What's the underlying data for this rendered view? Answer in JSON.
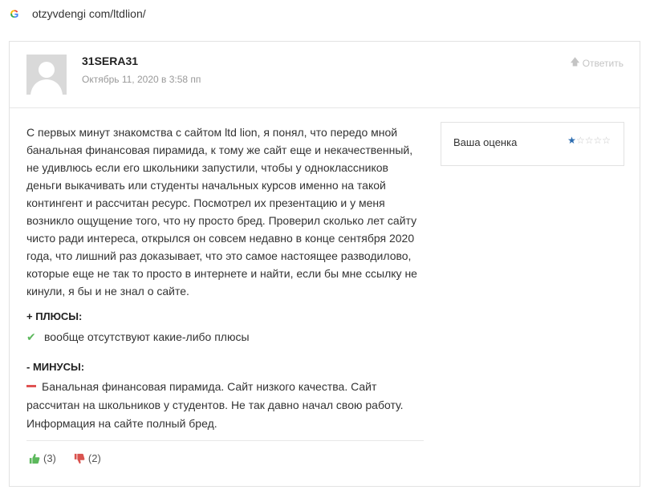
{
  "browser": {
    "url": "otzyvdengi com/ltdlion/"
  },
  "review": {
    "author": "31SERA31",
    "date": "Октябрь 11, 2020 в 3:58 пп",
    "reply_label": "Ответить",
    "body": "С первых минут знакомства с сайтом ltd lion, я понял, что передо мной банальная финансовая пирамида, к тому же сайт еще и некачественный, не удивлюсь если его школьники запустили, чтобы у одноклассников деньги выкачивать или студенты начальных курсов именно на такой контингент и рассчитан ресурс. Посмотрел их презентацию и у меня возникло ощущение того, что ну просто бред. Проверил сколько лет сайту чисто ради интереса, открылся он совсем недавно в конце сентября 2020 года, что лишний раз доказывает, что это самое настоящее разводилово, которые еще не так то просто в интернете и найти, если бы мне ссылку не кинули, я бы и не знал о сайте.",
    "rating": {
      "label": "Ваша оценка",
      "value": 1,
      "max": 5
    },
    "pros": {
      "title": "+ ПЛЮСЫ:",
      "items": [
        "вообще отсутствуют какие-либо плюсы"
      ]
    },
    "cons": {
      "title": "- МИНУСЫ:",
      "text": "Банальная финансовая пирамида. Сайт низкого качества. Сайт рассчитан на школьников у студентов. Не так давно начал свою работу. Информация на сайте полный бред."
    },
    "votes": {
      "up": "(3)",
      "down": "(2)"
    }
  },
  "colors": {
    "accent_blue": "#2b6cb0",
    "check_green": "#5cb85c",
    "minus_red": "#e05252",
    "thumb_up": "#5cb85c",
    "thumb_down": "#d9534f"
  },
  "icons": {
    "browser": "google-g-icon",
    "reply": "arrow-up-icon",
    "avatar": "default-user-avatar",
    "pros": "check-icon",
    "cons": "minus-icon",
    "vote_up": "thumbs-up-icon",
    "vote_down": "thumbs-down-icon"
  }
}
